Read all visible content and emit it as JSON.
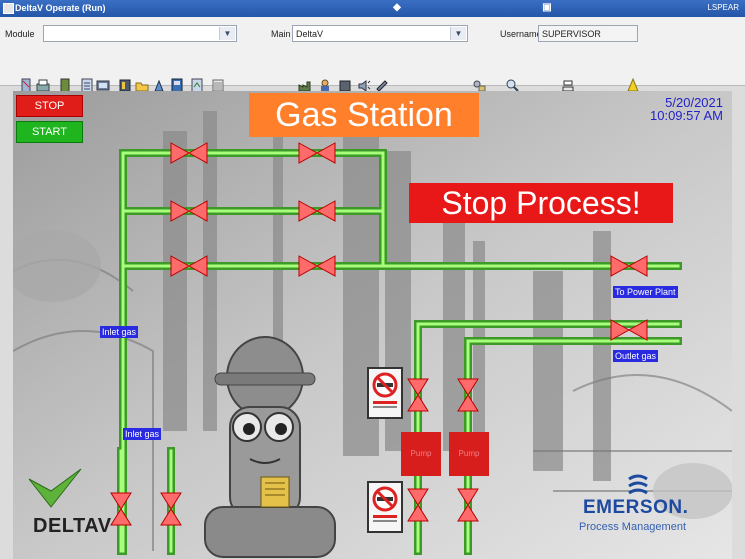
{
  "window": {
    "title": "DeltaV Operate (Run)",
    "user_tag": "LSPEAR"
  },
  "toolbar": {
    "module_label": "Module",
    "module_value": "",
    "main_label": "Main",
    "main_value": "DeltaV",
    "username_label": "Username",
    "username_value": "SUPERVISOR"
  },
  "hmi": {
    "stop_label": "STOP",
    "start_label": "START",
    "title": "Gas Station",
    "date": "5/20/2021",
    "time": "10:09:57 AM",
    "alarm_text": "Stop Process!",
    "tags": {
      "inlet_gas_1": "Inlet gas",
      "inlet_gas_2": "Inlet gas",
      "to_power_plant": "To Power Plant",
      "outlet_gas": "Outlet gas"
    },
    "logos": {
      "deltav": "DELTAV",
      "emerson": "EMERSON.",
      "emerson_sub": "Process Management"
    }
  },
  "colors": {
    "stop": "#e01d18",
    "start": "#1fb51f",
    "title_bg": "#ff7f2a",
    "alarm_bg": "#e81818",
    "tag_bg": "#2a2ae0",
    "pipe": "#7ef05a"
  }
}
